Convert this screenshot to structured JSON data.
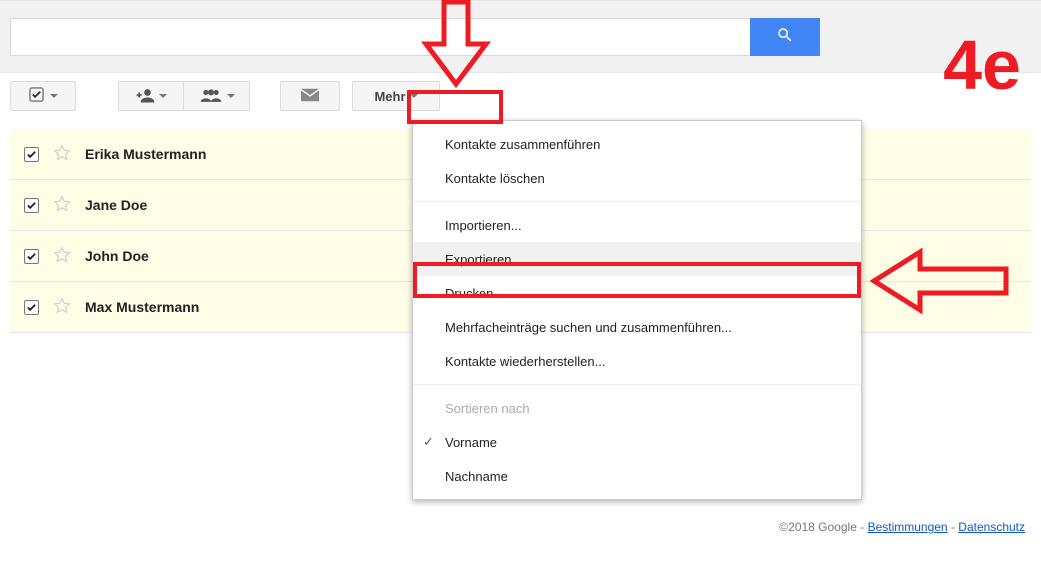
{
  "annotation": {
    "label": "4e"
  },
  "toolbar": {
    "more_label": "Mehr"
  },
  "contacts": [
    {
      "name": "Erika Mustermann",
      "checked": true
    },
    {
      "name": "Jane Doe",
      "checked": true
    },
    {
      "name": "John Doe",
      "checked": true
    },
    {
      "name": "Max Mustermann",
      "checked": true
    }
  ],
  "menu": {
    "merge": "Kontakte zusammenführen",
    "delete": "Kontakte löschen",
    "import": "Importieren...",
    "export": "Exportieren...",
    "print": "Drucken...",
    "find_merge": "Mehrfacheinträge suchen und zusammenführen...",
    "restore": "Kontakte wiederherstellen...",
    "sort_header": "Sortieren nach",
    "sort_first": "Vorname",
    "sort_last": "Nachname"
  },
  "footer": {
    "copyright": "©2018 Google",
    "terms": "Bestimmungen",
    "privacy": "Datenschutz"
  }
}
